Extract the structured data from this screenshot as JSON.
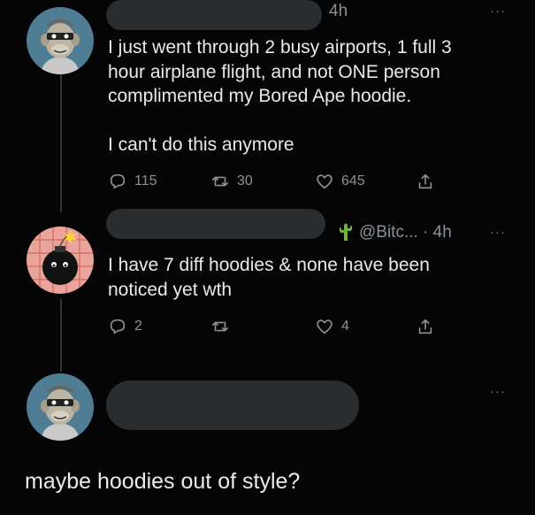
{
  "tweets": [
    {
      "time": "4h",
      "more": "···",
      "text": "I just went through 2 busy airports, 1 full 3\nhour airplane flight, and not ONE person\ncomplimented my Bored Ape hoodie.\n\nI can't do this anymore",
      "reply_count": "115",
      "retweet_count": "30",
      "like_count": "645",
      "avatar_icon": "bored-ape-avatar"
    },
    {
      "badge_icon": "cactus-icon",
      "handle_time": "@Bitc... · 4h",
      "more": "···",
      "text": "I have 7 diff hoodies & none have been\nnoticed yet wth",
      "reply_count": "2",
      "retweet_count": "",
      "like_count": "4",
      "avatar_icon": "bomb-avatar"
    },
    {
      "more": "···",
      "avatar_icon": "bored-ape-avatar"
    }
  ],
  "caption": "maybe hoodies out of style?",
  "colors": {
    "background": "#050505",
    "text": "#e7e9ea",
    "muted": "#8b9196",
    "redaction": "#2a2d30",
    "avatar_bg_blue": "#4f7d93",
    "avatar_bg_pink": "#e9a59c"
  }
}
